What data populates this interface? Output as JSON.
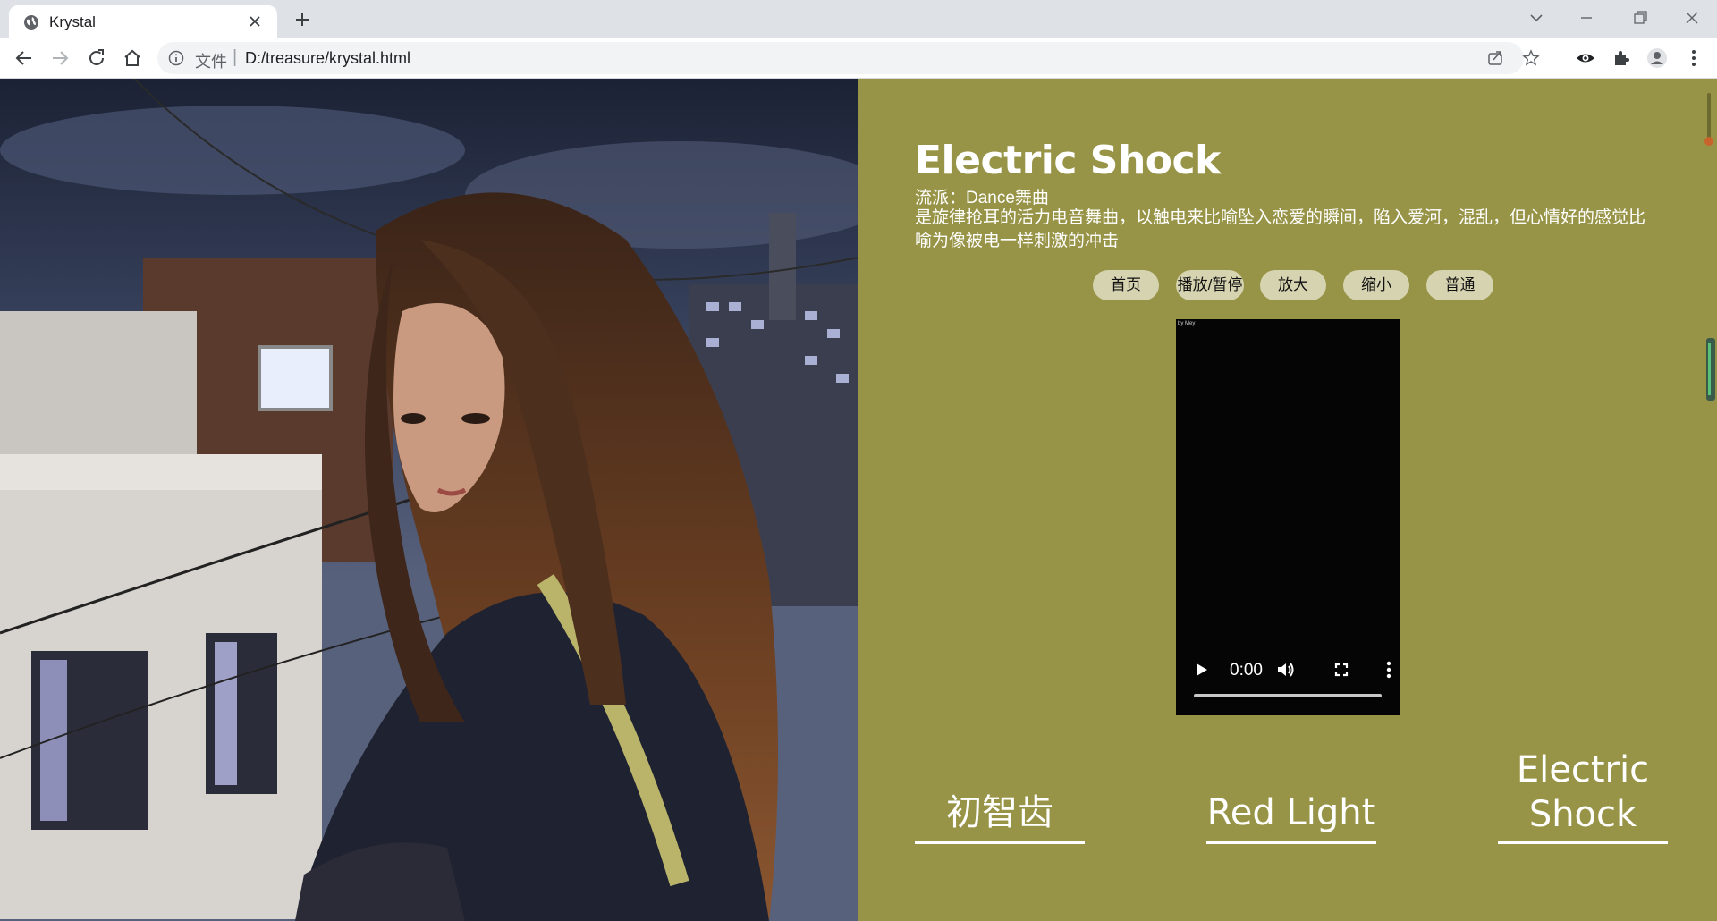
{
  "browser": {
    "tab_title": "Krystal",
    "address_protocol": "文件",
    "address_separator": "|",
    "url": "D:/treasure/krystal.html"
  },
  "page": {
    "song_title": "Electric Shock",
    "genre_line": "流派：Dance舞曲",
    "description": "是旋律抢耳的活力电音舞曲，以触电来比喻坠入恋爱的瞬间，陷入爱河，混乱，但心情好的感觉比喻为像被电一样刺激的冲击",
    "buttons": [
      "首页",
      "播放/暂停",
      "放大",
      "缩小",
      "普通"
    ],
    "video": {
      "watermark": "by Mey",
      "time": "0:00",
      "progress": 0
    },
    "nav_links": [
      "初智齿",
      "Red Light",
      "Electric Shock"
    ],
    "colors": {
      "background": "#989447",
      "button": "#d6d3b0",
      "text": "#ffffff"
    }
  }
}
